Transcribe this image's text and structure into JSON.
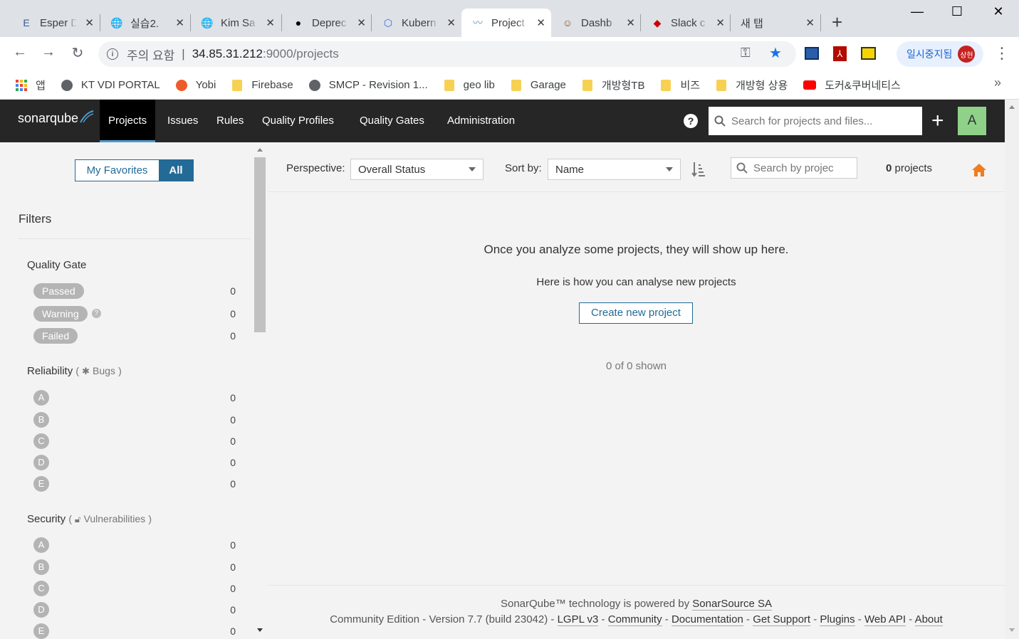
{
  "browser": {
    "tabs": [
      {
        "label": "Esper D",
        "icon": "E",
        "icon_color": "#3a5a9b"
      },
      {
        "label": "실습2.",
        "icon": "🌐",
        "icon_color": "#5f6368"
      },
      {
        "label": "Kim Sa",
        "icon": "🌐",
        "icon_color": "#5f6368"
      },
      {
        "label": "Deprec",
        "icon": "●",
        "icon_color": "#000000"
      },
      {
        "label": "Kubern",
        "icon": "⬡",
        "icon_color": "#326ce5"
      },
      {
        "label": "Project",
        "icon": "〰",
        "icon_color": "#4e9bcd"
      },
      {
        "label": "Dashb",
        "icon": "☺",
        "icon_color": "#8b5a2b"
      },
      {
        "label": "Slack c",
        "icon": "◆",
        "icon_color": "#cc0000"
      },
      {
        "label": "새 탭",
        "icon": "",
        "icon_color": "#5f6368"
      }
    ],
    "close_glyph": "✕",
    "new_tab_glyph": "+",
    "win_minimize": "—",
    "win_maximize": "☐",
    "win_close": "✕",
    "back_glyph": "←",
    "forward_glyph": "→",
    "reload_glyph": "↻",
    "security_label": "주의 요함",
    "url_host": "34.85.31.212",
    "url_rest": ":9000/projects",
    "key_glyph": "⚿",
    "star_glyph": "★",
    "profile_label": "일시중지됨",
    "profile_avatar": "상현",
    "menu_glyph": "⋮",
    "bookmarks": [
      {
        "label": "앱",
        "type": "apps"
      },
      {
        "label": "KT VDI PORTAL",
        "type": "globe"
      },
      {
        "label": "Yobi",
        "type": "yobi"
      },
      {
        "label": "Firebase",
        "type": "folder"
      },
      {
        "label": "SMCP - Revision 1...",
        "type": "globe"
      },
      {
        "label": "geo lib",
        "type": "folder"
      },
      {
        "label": "Garage",
        "type": "folder"
      },
      {
        "label": "개방형TB",
        "type": "folder"
      },
      {
        "label": "비즈",
        "type": "folder"
      },
      {
        "label": "개방형 상용",
        "type": "folder"
      },
      {
        "label": "도커&쿠버네티스",
        "type": "youtube"
      }
    ],
    "bookmarks_overflow": "»"
  },
  "sonar": {
    "logo": "sonarqube",
    "nav": [
      "Projects",
      "Issues",
      "Rules",
      "Quality Profiles",
      "Quality Gates",
      "Administration"
    ],
    "help_glyph": "?",
    "search_placeholder": "Search for projects and files...",
    "plus_glyph": "+",
    "avatar_letter": "A"
  },
  "sidebar": {
    "my_favorites": "My Favorites",
    "all": "All",
    "filters_title": "Filters",
    "quality_gate": {
      "title": "Quality Gate",
      "items": [
        {
          "label": "Passed",
          "count": "0"
        },
        {
          "label": "Warning",
          "count": "0"
        },
        {
          "label": "Failed",
          "count": "0"
        }
      ]
    },
    "reliability": {
      "title": "Reliability",
      "sub": "Bugs",
      "items": [
        {
          "label": "A",
          "count": "0"
        },
        {
          "label": "B",
          "count": "0"
        },
        {
          "label": "C",
          "count": "0"
        },
        {
          "label": "D",
          "count": "0"
        },
        {
          "label": "E",
          "count": "0"
        }
      ]
    },
    "security": {
      "title": "Security",
      "sub": "Vulnerabilities",
      "items": [
        {
          "label": "A",
          "count": "0"
        },
        {
          "label": "B",
          "count": "0"
        },
        {
          "label": "C",
          "count": "0"
        },
        {
          "label": "D",
          "count": "0"
        },
        {
          "label": "E",
          "count": "0"
        }
      ]
    }
  },
  "main": {
    "perspective_label": "Perspective:",
    "perspective_value": "Overall Status",
    "sort_label": "Sort by:",
    "sort_value": "Name",
    "search_placeholder": "Search by projec",
    "projects_count": "0",
    "projects_word": "projects",
    "empty_title": "Once you analyze some projects, they will show up here.",
    "empty_sub": "Here is how you can analyse new projects",
    "create_button": "Create new project",
    "shown": "0 of 0 shown"
  },
  "footer": {
    "line1_prefix": "SonarQube™ technology is powered by ",
    "line1_link": "SonarSource SA",
    "edition": "Community Edition",
    "version": "Version 7.7 (build 23042)",
    "license": "LGPL v3",
    "links": [
      "Community",
      "Documentation",
      "Get Support",
      "Plugins",
      "Web API",
      "About"
    ],
    "sep": " - "
  },
  "colors": {
    "nav_bg": "#262626",
    "accent": "#236a97",
    "avatar_bg": "#90d189",
    "home_icon": "#f17c1d"
  }
}
